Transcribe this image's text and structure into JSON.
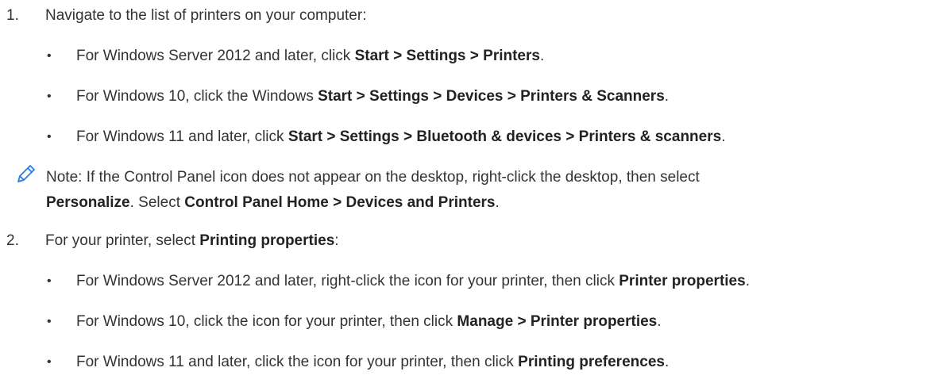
{
  "steps": [
    {
      "number": "1.",
      "text": "Navigate to the list of printers on your computer:",
      "bullets": [
        {
          "pre": "For Windows Server 2012 and later, click ",
          "bold": "Start > Settings > Printers",
          "post": "."
        },
        {
          "pre": "For Windows 10, click the Windows ",
          "bold": "Start > Settings > Devices > Printers & Scanners",
          "post": "."
        },
        {
          "pre": "For Windows 11 and later, click ",
          "bold": "Start > Settings > Bluetooth & devices > Printers & scanners",
          "post": "."
        }
      ]
    },
    {
      "number": "2.",
      "text_pre": "For your printer, select ",
      "text_bold": "Printing properties",
      "text_post": ":",
      "bullets": [
        {
          "pre": "For Windows Server 2012 and later, right-click the icon for your printer, then click ",
          "bold": "Printer properties",
          "post": "."
        },
        {
          "pre": "For Windows 10, click the icon for your printer, then click ",
          "bold": "Manage > Printer properties",
          "post": "."
        },
        {
          "pre": "For Windows 11 and later, click the icon for your printer, then click ",
          "bold": "Printing preferences",
          "post": "."
        }
      ]
    }
  ],
  "note": {
    "icon": "pencil-icon",
    "line1": "Note: If the Control Panel icon does not appear on the desktop, right-click the desktop, then select",
    "line2_bold1": "Personalize",
    "line2_mid": ". Select ",
    "line2_bold2": "Control Panel Home > Devices and Printers",
    "line2_end": "."
  },
  "colors": {
    "text": "#333333",
    "icon": "#2a7de1"
  }
}
